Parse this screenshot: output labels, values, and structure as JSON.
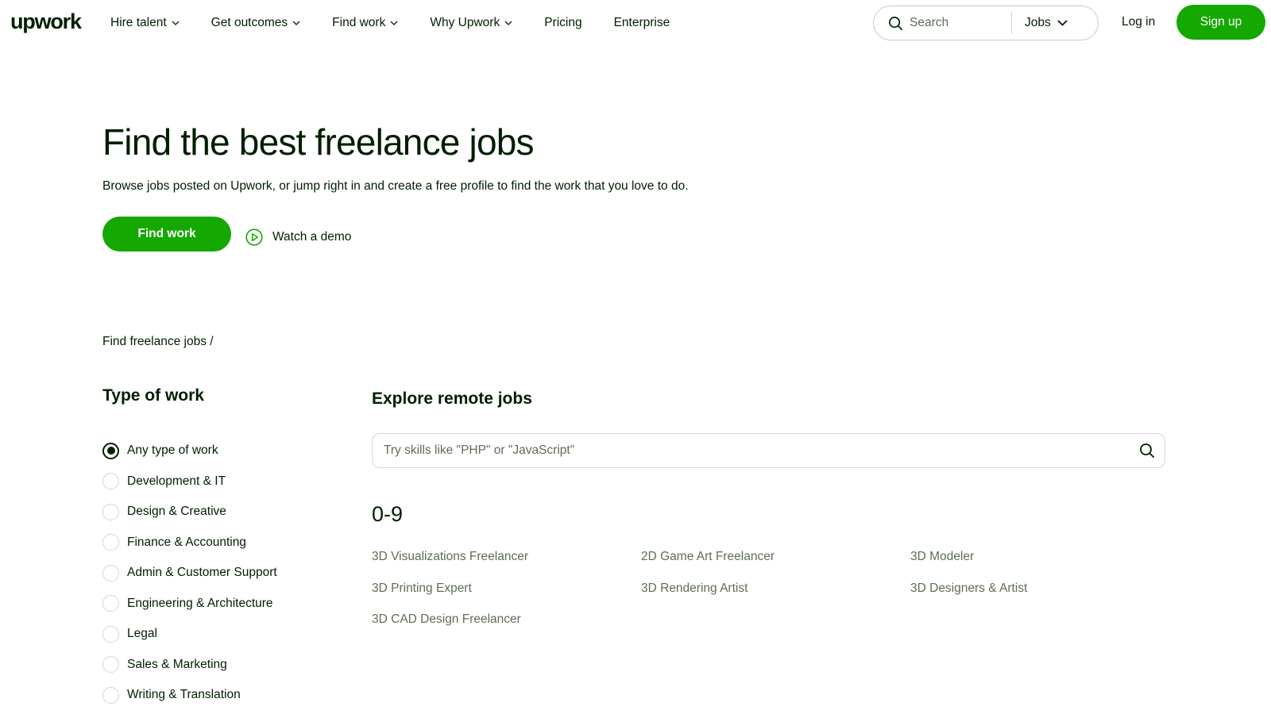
{
  "header": {
    "logo": "upwork",
    "nav": [
      {
        "label": "Hire talent",
        "has_dropdown": true
      },
      {
        "label": "Get outcomes",
        "has_dropdown": true
      },
      {
        "label": "Find work",
        "has_dropdown": true
      },
      {
        "label": "Why Upwork",
        "has_dropdown": true
      },
      {
        "label": "Pricing",
        "has_dropdown": false
      },
      {
        "label": "Enterprise",
        "has_dropdown": false
      }
    ],
    "search": {
      "placeholder": "Search",
      "category": "Jobs"
    },
    "login_label": "Log in",
    "signup_label": "Sign up"
  },
  "hero": {
    "title": "Find the best freelance jobs",
    "subtitle": "Browse jobs posted on Upwork, or jump right in and create a free profile to find the work that you love to do.",
    "cta_label": "Find work",
    "demo_label": "Watch a demo"
  },
  "breadcrumb": "Find freelance jobs /",
  "sidebar": {
    "title": "Type of work",
    "options": [
      {
        "label": "Any type of work",
        "selected": true
      },
      {
        "label": "Development & IT",
        "selected": false
      },
      {
        "label": "Design & Creative",
        "selected": false
      },
      {
        "label": "Finance & Accounting",
        "selected": false
      },
      {
        "label": "Admin & Customer Support",
        "selected": false
      },
      {
        "label": "Engineering & Architecture",
        "selected": false
      },
      {
        "label": "Legal",
        "selected": false
      },
      {
        "label": "Sales & Marketing",
        "selected": false
      },
      {
        "label": "Writing & Translation",
        "selected": false
      }
    ]
  },
  "main": {
    "title": "Explore remote jobs",
    "search_placeholder": "Try skills like \"PHP\" or \"JavaScript\"",
    "section_heading": "0-9",
    "jobs": [
      "3D Visualizations Freelancer",
      "2D Game Art Freelancer",
      "3D Modeler",
      "3D Printing Expert",
      "3D Rendering Artist",
      "3D Designers & Artist",
      "3D CAD Design Freelancer"
    ]
  },
  "colors": {
    "brand_green": "#14a800",
    "text_dark": "#001e00",
    "text_muted": "#5e6d55",
    "border": "#d5d5d5"
  },
  "icons": {
    "search": "search-icon",
    "chevron": "chevron-down-icon",
    "play": "play-circle-icon"
  }
}
